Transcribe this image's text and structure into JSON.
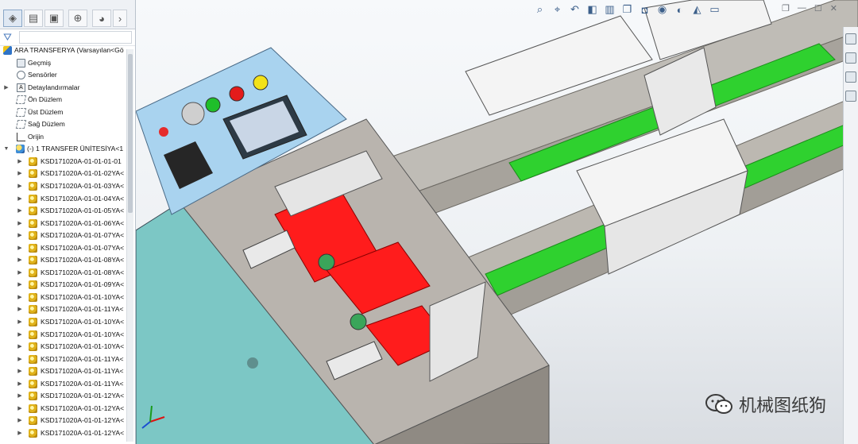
{
  "tree": {
    "root_label": "ARA TRANSFERYA  (Varsayılan<Gö",
    "items": [
      {
        "label": "Geçmiş",
        "icon": "history-folder-icon"
      },
      {
        "label": "Sensörler",
        "icon": "sensor-icon"
      },
      {
        "label": "Detaylandırmalar",
        "icon": "annotations-icon"
      },
      {
        "label": "Ön Düzlem",
        "icon": "plane-icon"
      },
      {
        "label": "Üst Düzlem",
        "icon": "plane-icon"
      },
      {
        "label": "Sağ Düzlem",
        "icon": "plane-icon"
      },
      {
        "label": "Orijin",
        "icon": "origin-icon"
      }
    ],
    "assembly_label": "(-) 1 TRANSFER ÜNİTESİYA<1",
    "parts": [
      "KSD171020A-01-01-01-01",
      "KSD171020A-01-01-02YA<",
      "KSD171020A-01-01-03YA<",
      "KSD171020A-01-01-04YA<",
      "KSD171020A-01-01-05YA<",
      "KSD171020A-01-01-06YA<",
      "KSD171020A-01-01-07YA<",
      "KSD171020A-01-01-07YA<",
      "KSD171020A-01-01-08YA<",
      "KSD171020A-01-01-08YA<",
      "KSD171020A-01-01-09YA<",
      "KSD171020A-01-01-10YA<",
      "KSD171020A-01-01-11YA<",
      "KSD171020A-01-01-10YA<",
      "KSD171020A-01-01-10YA<",
      "KSD171020A-01-01-10YA<",
      "KSD171020A-01-01-11YA<",
      "KSD171020A-01-01-11YA<",
      "KSD171020A-01-01-11YA<",
      "KSD171020A-01-01-12YA<",
      "KSD171020A-01-01-12YA<",
      "KSD171020A-01-01-12YA<",
      "KSD171020A-01-01-12YA<"
    ]
  },
  "panel_tabs": [
    "feature-manager-icon",
    "property-manager-icon",
    "configuration-manager-icon",
    "dimxpert-icon",
    "display-manager-icon",
    "more-icon"
  ],
  "heads_up_toolbar": [
    "zoom-to-fit-icon",
    "zoom-area-icon",
    "previous-view-icon",
    "section-view-icon",
    "dynamic-annotation-icon",
    "view-orientation-icon",
    "display-style-icon",
    "hide-show-icon",
    "edit-appearance-icon",
    "apply-scene-icon",
    "view-settings-icon"
  ],
  "watermark": {
    "text": "机械图纸狗"
  },
  "colors": {
    "accent": "#2e73c7",
    "conveyor_green": "#2fd12f",
    "belt_red": "#ff1c1c",
    "panel_blue": "#a9d3ef"
  }
}
